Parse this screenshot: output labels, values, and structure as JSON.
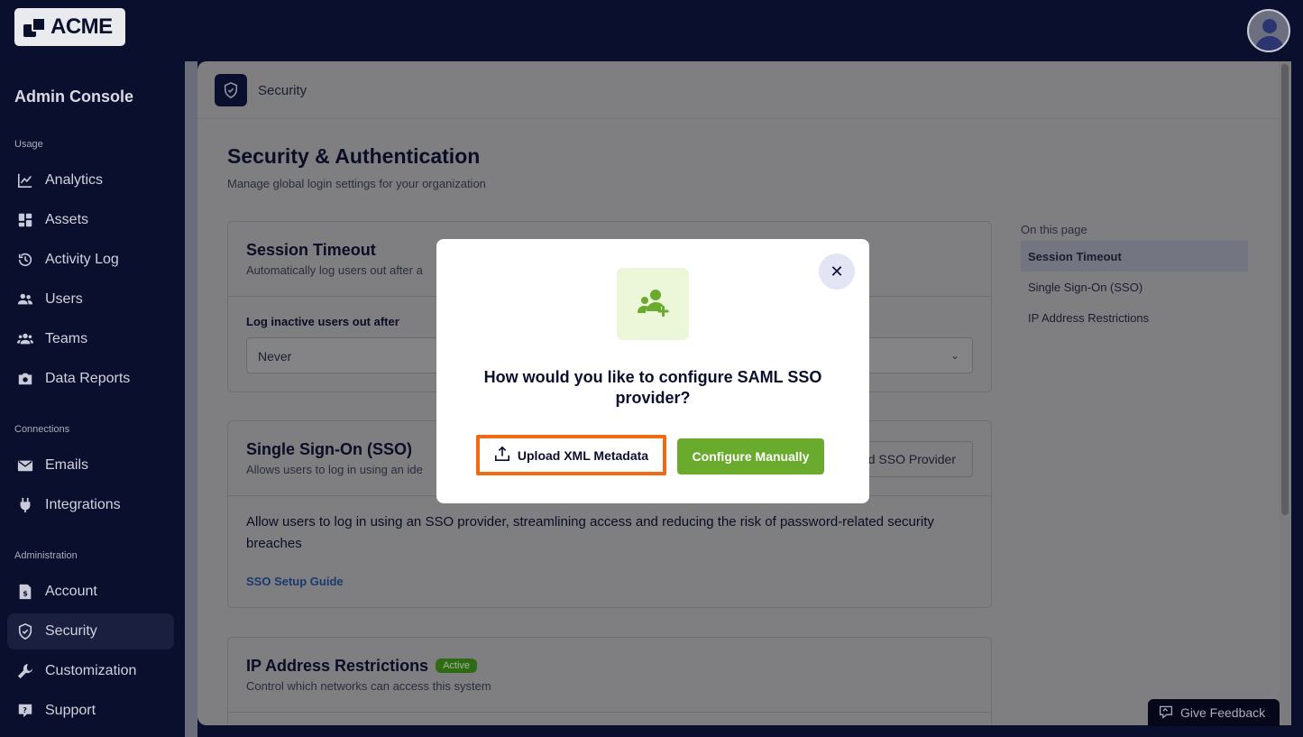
{
  "brand": {
    "logo_text": "ACME"
  },
  "sidebar": {
    "title": "Admin Console",
    "sections": {
      "usage": "Usage",
      "connections": "Connections",
      "administration": "Administration"
    },
    "items": {
      "analytics": "Analytics",
      "assets": "Assets",
      "activity_log": "Activity Log",
      "users": "Users",
      "teams": "Teams",
      "data_reports": "Data Reports",
      "emails": "Emails",
      "integrations": "Integrations",
      "account": "Account",
      "security": "Security",
      "customization": "Customization",
      "support": "Support"
    },
    "active_item": "security"
  },
  "header": {
    "title": "Security"
  },
  "page": {
    "title": "Security & Authentication",
    "subtitle": "Manage global login settings for your organization"
  },
  "session_timeout": {
    "title": "Session Timeout",
    "desc": "Automatically log users out after a",
    "field_label": "Log inactive users out after",
    "field_value": "Never"
  },
  "sso": {
    "title": "Single Sign-On (SSO)",
    "desc": "Allows users to log in using an ide",
    "add_button": "d SSO Provider",
    "body": "Allow users to log in using an SSO provider, streamlining access and reducing the risk of password-related security breaches",
    "guide_link": "SSO Setup Guide"
  },
  "ip_restrictions": {
    "title": "IP Address Restrictions",
    "badge": "Active",
    "desc": "Control which networks can access this system"
  },
  "toc": {
    "label": "On this page",
    "items": [
      "Session Timeout",
      "Single Sign-On (SSO)",
      "IP Address Restrictions"
    ]
  },
  "feedback": {
    "label": "Give Feedback"
  },
  "modal": {
    "title": "How would you like to configure SAML SSO provider?",
    "upload_button": "Upload XML Metadata",
    "manual_button": "Configure Manually",
    "close_glyph": "✕"
  },
  "colors": {
    "navy": "#0b0f2e",
    "accent_green": "#6aaa2c",
    "highlight_orange": "#f06a13",
    "icon_bg": "#ecf7d9"
  }
}
